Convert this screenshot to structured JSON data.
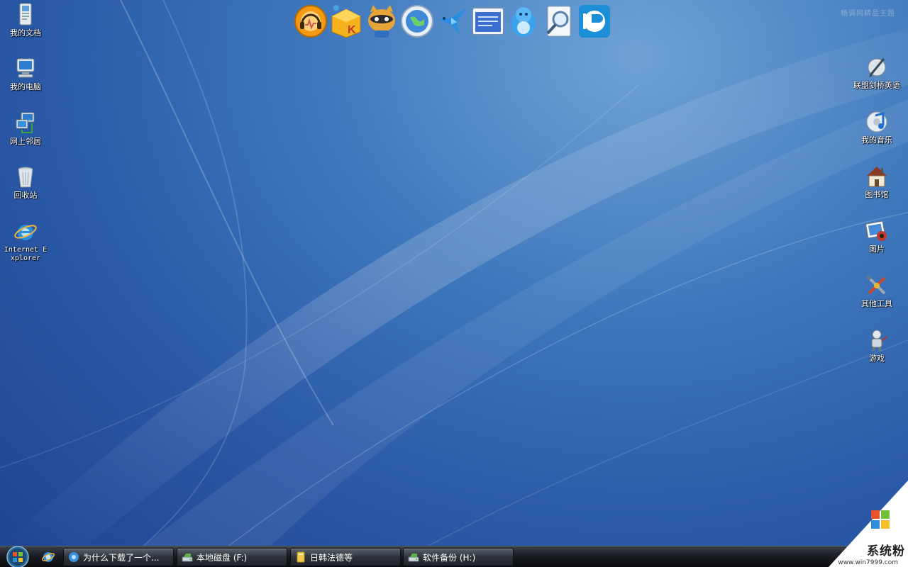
{
  "watermark_top": "杨调网精品主题",
  "desktop_left": [
    {
      "label": "我的文档",
      "icon": "my-documents-icon"
    },
    {
      "label": "我的电脑",
      "icon": "my-computer-icon"
    },
    {
      "label": "网上邻居",
      "icon": "network-places-icon"
    },
    {
      "label": "回收站",
      "icon": "recycle-bin-icon"
    },
    {
      "label": "Internet Explorer",
      "icon": "internet-explorer-icon"
    }
  ],
  "desktop_right": [
    {
      "label": "联盟剑桥英语",
      "icon": "pen-icon"
    },
    {
      "label": "我的音乐",
      "icon": "music-note-icon"
    },
    {
      "label": "图书馆",
      "icon": "house-icon"
    },
    {
      "label": "图片",
      "icon": "pictures-icon"
    },
    {
      "label": "其他工具",
      "icon": "tools-icon"
    },
    {
      "label": "游戏",
      "icon": "game-robot-icon"
    }
  ],
  "dock": [
    {
      "icon": "headphones-player-icon",
      "color": "#f39a12"
    },
    {
      "icon": "karaoke-k-box-icon",
      "color": "#f5b21c"
    },
    {
      "icon": "raccoon-chat-icon",
      "color": "#e7a538"
    },
    {
      "icon": "globe-browser-icon",
      "color": "#3f88d8"
    },
    {
      "icon": "hummingbird-download-icon",
      "color": "#2a8ee0"
    },
    {
      "icon": "mail-window-icon",
      "color": "#3a6fd0"
    },
    {
      "icon": "penguin-qq-icon",
      "color": "#3aa2ee"
    },
    {
      "icon": "magnifier-search-icon",
      "color": "#dfe8f2"
    },
    {
      "icon": "pplive-player-icon",
      "color": "#1c8fd8"
    }
  ],
  "taskbar": {
    "tasks": [
      {
        "label": "为什么下载了一个...",
        "icon": "ie-globe-icon"
      },
      {
        "label": "本地磁盘 (F:)",
        "icon": "drive-icon"
      },
      {
        "label": "日韩法德等",
        "icon": "folder-icon"
      },
      {
        "label": "软件备份 (H:)",
        "icon": "drive-icon"
      }
    ]
  },
  "brand": {
    "text": "系统粉",
    "url": "www.win7999.com"
  }
}
